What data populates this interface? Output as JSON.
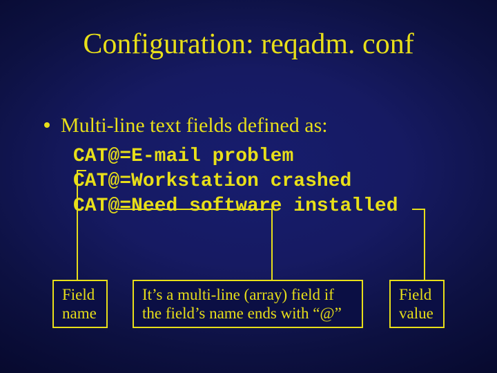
{
  "title": "Configuration: reqadm. conf",
  "bullet": "Multi-line text fields defined as:",
  "code": {
    "line1_name": "CAT@",
    "line1_sep": "=",
    "line1_val": "E-mail problem",
    "line2_name": "CAT@",
    "line2_sep": "=",
    "line2_val": "Workstation crashed",
    "line3_name": "CAT@",
    "line3_sep": "=",
    "line3_val": "Need software installed"
  },
  "callouts": {
    "field_name": "Field name",
    "multiline_note": "It’s a multi-line (array) field if the field’s name ends with “@”",
    "field_value": "Field value"
  }
}
